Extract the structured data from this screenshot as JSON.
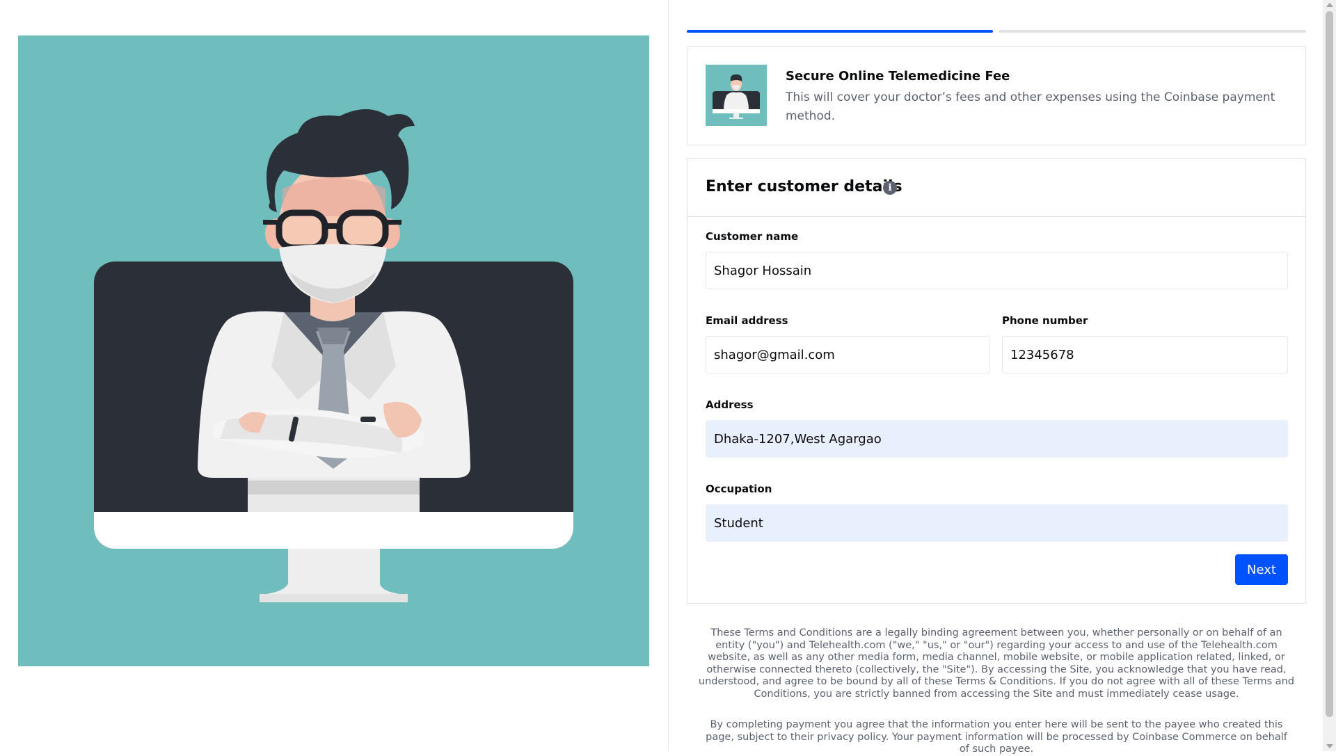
{
  "product": {
    "title": "Secure Online Telemedicine Fee",
    "description": "This will cover your doctor’s fees and other expenses using the Coinbase payment method.",
    "thumbnail_icon": "doctor-illustration"
  },
  "progress": {
    "current_step": 1,
    "total_steps": 2
  },
  "form": {
    "title": "Enter customer details",
    "info_icon": "info-icon",
    "fields": {
      "customer_name": {
        "label": "Customer name",
        "value": "Shagor Hossain"
      },
      "email": {
        "label": "Email address",
        "value": "shagor@gmail.com"
      },
      "phone": {
        "label": "Phone number",
        "value": "12345678"
      },
      "address": {
        "label": "Address",
        "value": "Dhaka-1207,West Agargao"
      },
      "occupation": {
        "label": "Occupation",
        "value": "Student"
      }
    },
    "next_label": "Next"
  },
  "legal": {
    "terms": "These Terms and Conditions are a legally binding agreement between you, whether personally or on behalf of an entity (\"you\") and Telehealth.com (\"we,\" \"us,\" or \"our\") regarding your access to and use of the Telehealth.com website, as well as any other media form, media channel, mobile website, or mobile application related, linked, or otherwise connected thereto (collectively, the \"Site\"). By accessing the Site, you acknowledge that you have read, understood, and agree to be bound by all of these Terms & Conditions. If you do not agree with all of these Terms and Conditions, you are strictly banned from accessing the Site and must immediately cease usage.",
    "payment": "By completing payment you agree that the information you enter here will be sent to the payee who created this page, subject to their privacy policy. Your payment information will be processed by Coinbase Commerce on behalf of such payee."
  },
  "colors": {
    "accent": "#0052ff",
    "illustration_bg": "#70bdbd",
    "autofill_bg": "#e8f0fe"
  }
}
